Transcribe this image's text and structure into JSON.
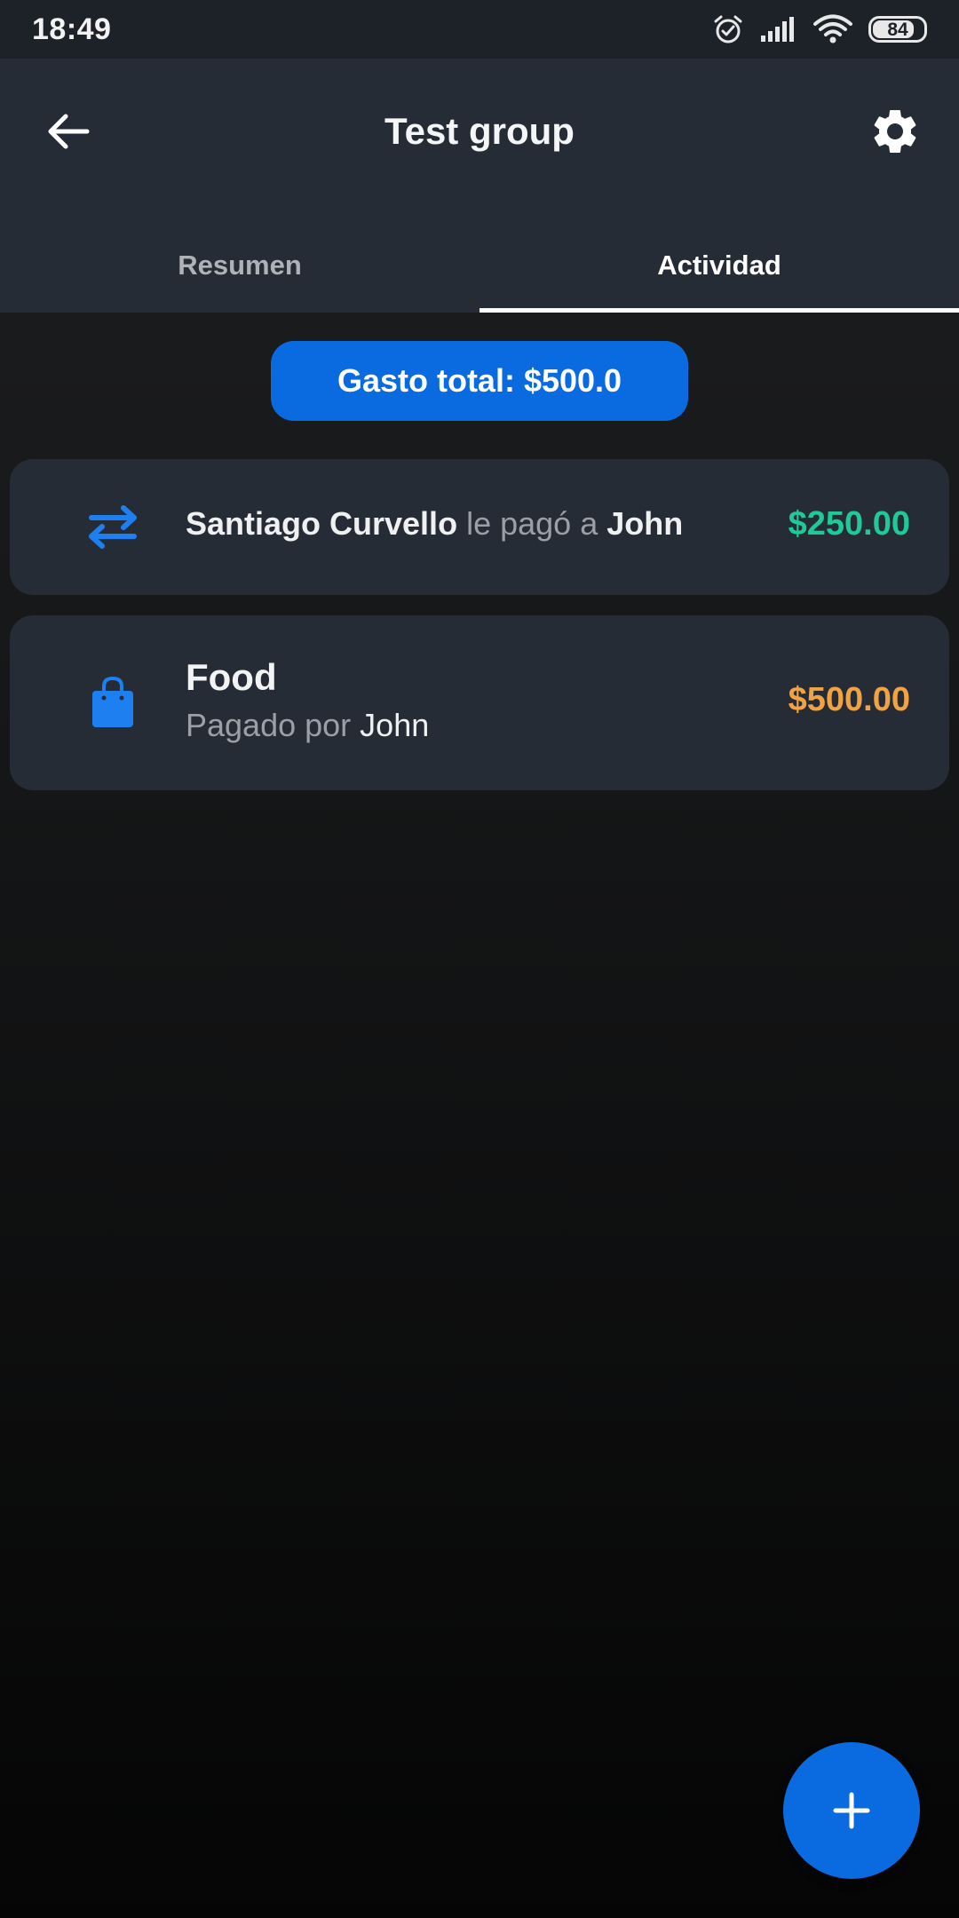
{
  "status_bar": {
    "time": "18:49",
    "battery": "84",
    "battery_level": 0.84,
    "icons": [
      "alarm-icon",
      "signal-icon",
      "wifi-icon",
      "battery-icon"
    ]
  },
  "header": {
    "title": "Test group",
    "back_icon": "arrow-back-icon",
    "settings_icon": "gear-icon"
  },
  "tabs": [
    {
      "label": "Resumen",
      "active": false
    },
    {
      "label": "Actividad",
      "active": true
    }
  ],
  "summary": {
    "total_label": "Gasto total:",
    "total_value": "$500.0"
  },
  "activity": [
    {
      "type": "payment",
      "icon": "transfer-arrows-icon",
      "from": "Santiago Curvello",
      "connector": "le pagó a",
      "to": "John",
      "amount": "$250.00",
      "amount_color": "#1fc99a"
    },
    {
      "type": "expense",
      "icon": "shopping-bag-icon",
      "title": "Food",
      "paid_by_label": "Pagado por",
      "payer": "John",
      "amount": "$500.00",
      "amount_color": "#f1a243"
    }
  ],
  "fab": {
    "icon": "plus-icon"
  },
  "colors": {
    "accent": "#0a6be1",
    "surface": "#262c35",
    "status_bar": "#1d2128"
  }
}
